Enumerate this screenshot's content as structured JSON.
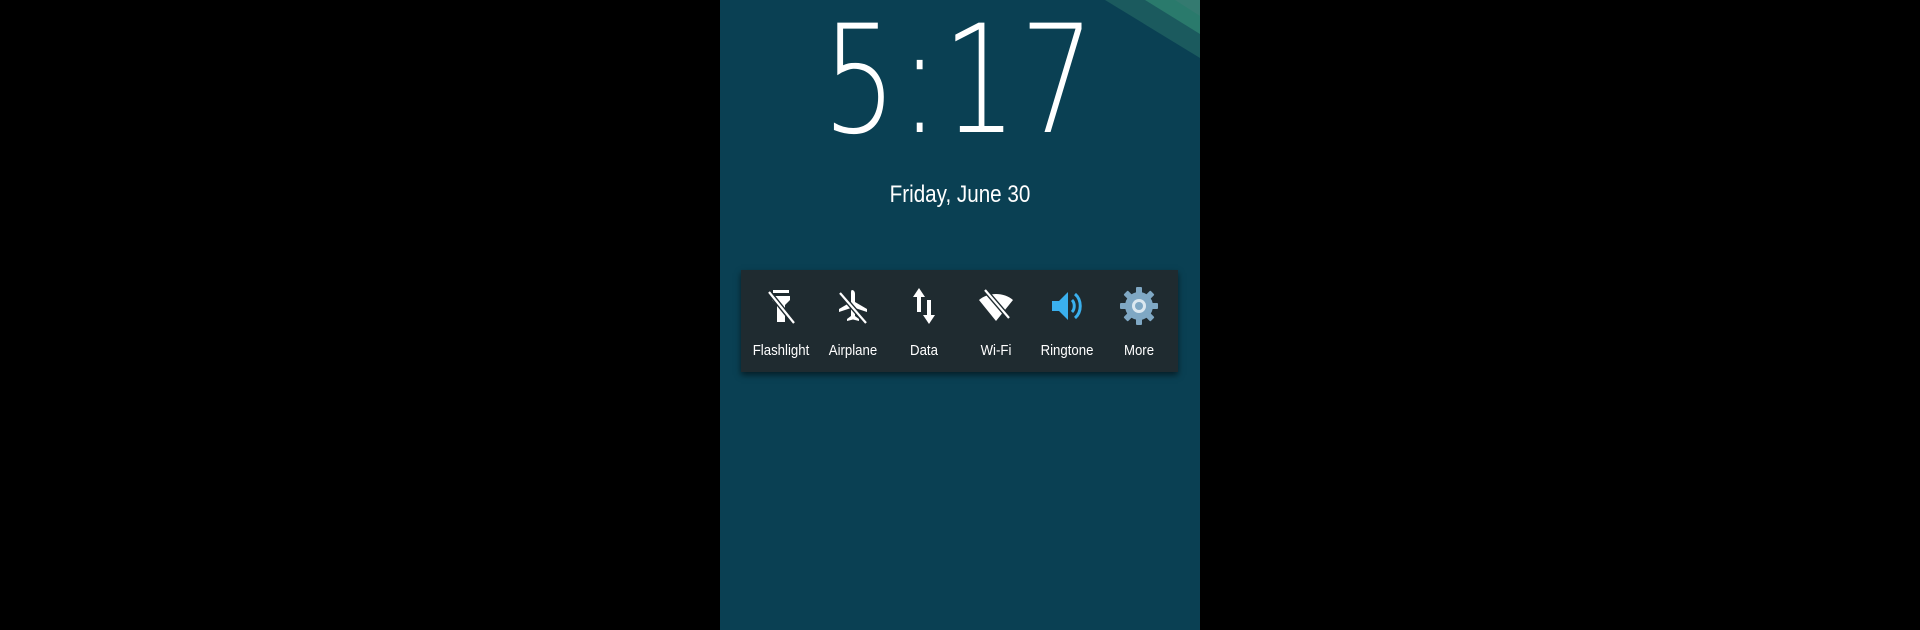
{
  "lockscreen": {
    "time": "5:17",
    "date": "Friday, June 30"
  },
  "colors": {
    "wallpaper": "#0a4053",
    "panel": "#1f2b30",
    "active_icon": "#3ab0ee",
    "settings_icon": "#7fa8c4",
    "text": "#ffffff"
  },
  "quick_settings": {
    "tiles": [
      {
        "label": "Flashlight",
        "icon": "flashlight-off-icon"
      },
      {
        "label": "Airplane",
        "icon": "airplane-off-icon"
      },
      {
        "label": "Data",
        "icon": "mobile-data-icon"
      },
      {
        "label": "Wi-Fi",
        "icon": "wifi-off-icon"
      },
      {
        "label": "Ringtone",
        "icon": "volume-icon"
      },
      {
        "label": "More",
        "icon": "settings-gear-icon"
      }
    ]
  }
}
